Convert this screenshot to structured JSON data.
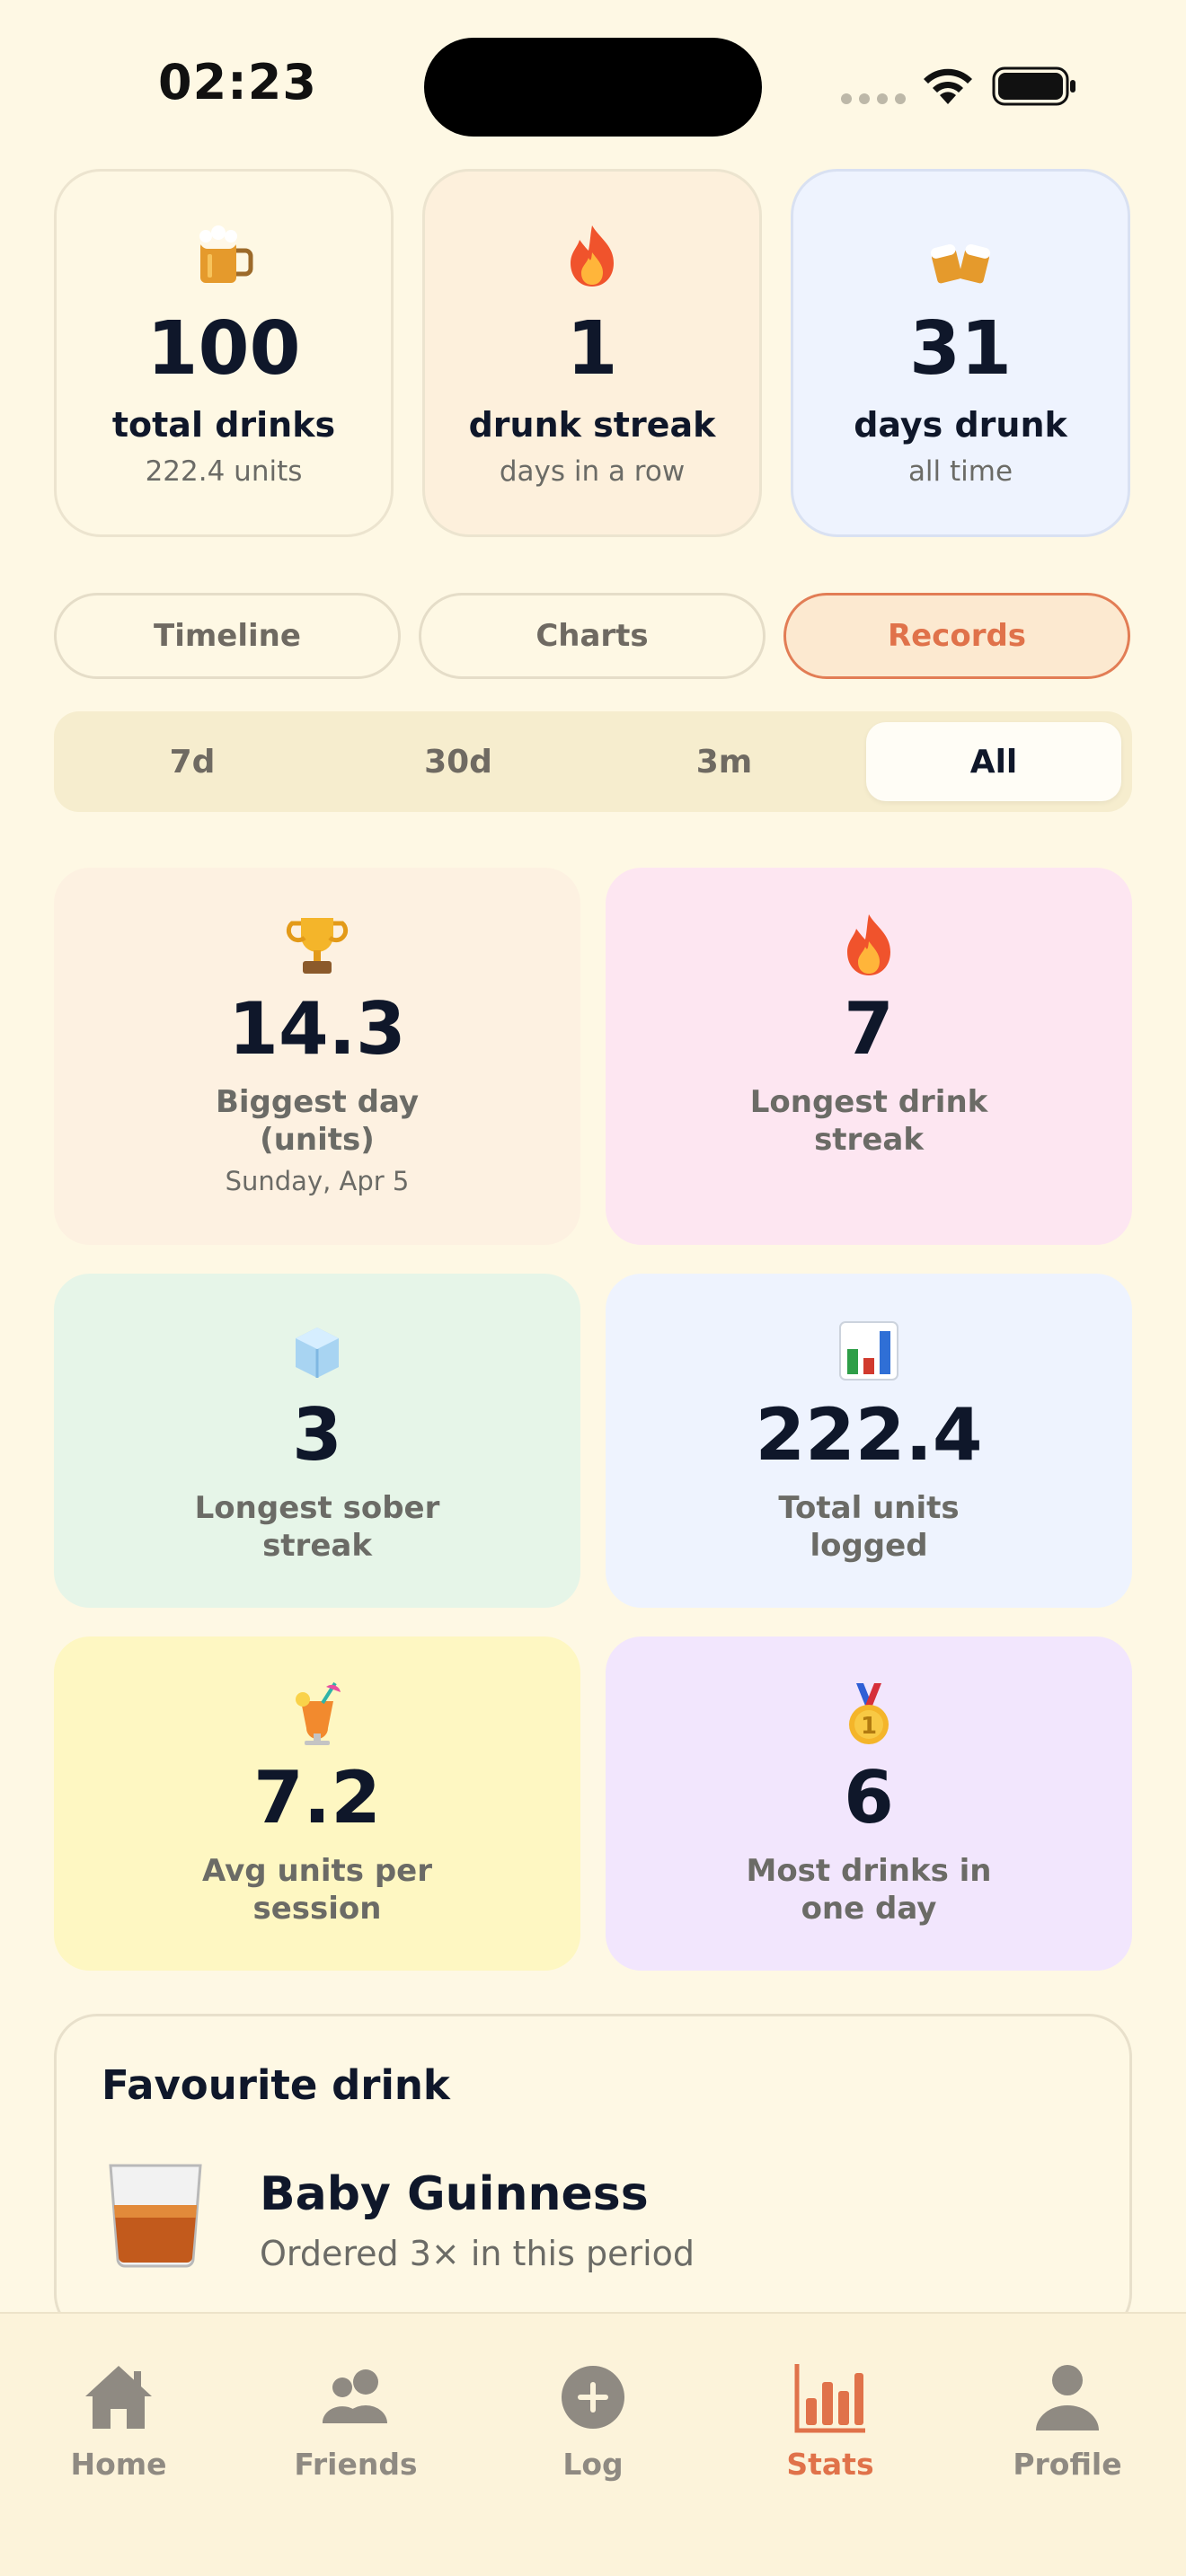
{
  "status_bar": {
    "time": "02:23"
  },
  "summary_cards": [
    {
      "icon": "beer-mug-icon",
      "value": "100",
      "label": "total drinks",
      "sub": "222.4 units",
      "bg": "#FEF8E4"
    },
    {
      "icon": "fire-icon",
      "value": "1",
      "label": "drunk streak",
      "sub": "days in a row",
      "bg": "#FDF0DC"
    },
    {
      "icon": "clinking-beer-mugs-icon",
      "value": "31",
      "label": "days drunk",
      "sub": "all time",
      "bg": "#EEF3FE"
    }
  ],
  "view_tabs": [
    {
      "label": "Timeline",
      "active": false
    },
    {
      "label": "Charts",
      "active": false
    },
    {
      "label": "Records",
      "active": true
    }
  ],
  "periods": [
    {
      "label": "7d",
      "selected": false
    },
    {
      "label": "30d",
      "selected": false
    },
    {
      "label": "3m",
      "selected": false
    },
    {
      "label": "All",
      "selected": true
    }
  ],
  "records": [
    {
      "icon": "trophy-icon",
      "value": "14.3",
      "label": "Biggest day (units)",
      "sub": "Sunday, Apr 5",
      "bg": "#FDF1E1"
    },
    {
      "icon": "fire-icon",
      "value": "7",
      "label": "Longest drink streak",
      "sub": "",
      "bg": "#FDE6F1"
    },
    {
      "icon": "ice-cube-icon",
      "value": "3",
      "label": "Longest sober streak",
      "sub": "",
      "bg": "#E6F5E8"
    },
    {
      "icon": "bar-chart-icon",
      "value": "222.4",
      "label": "Total units logged",
      "sub": "",
      "bg": "#EEF3FE"
    },
    {
      "icon": "tropical-drink-icon",
      "value": "7.2",
      "label": "Avg units per session",
      "sub": "",
      "bg": "#FEF7C2"
    },
    {
      "icon": "gold-medal-icon",
      "value": "6",
      "label": "Most drinks in one day",
      "sub": "",
      "bg": "#F2E6FD"
    }
  ],
  "favourite": {
    "title": "Favourite drink",
    "icon": "whisky-glass-icon",
    "name": "Baby Guinness",
    "sub": "Ordered 3× in this period"
  },
  "tabbar": [
    {
      "icon": "home-icon",
      "label": "Home",
      "active": false
    },
    {
      "icon": "friends-icon",
      "label": "Friends",
      "active": false
    },
    {
      "icon": "plus-circle-icon",
      "label": "Log",
      "active": false
    },
    {
      "icon": "stats-icon",
      "label": "Stats",
      "active": true
    },
    {
      "icon": "profile-icon",
      "label": "Profile",
      "active": false
    }
  ],
  "colors": {
    "background": "#FEF8E4",
    "accent": "#E0724A",
    "text_dark": "#0F172A",
    "text_muted": "#6B6B66",
    "tab_inactive": "#8F8A82"
  }
}
